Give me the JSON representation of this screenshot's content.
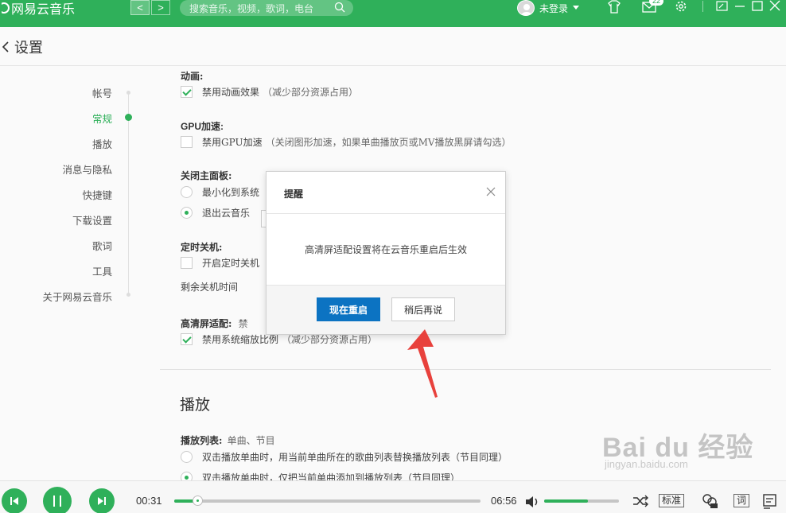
{
  "app": {
    "name": "网易云音乐"
  },
  "topbar": {
    "prev_glyph": "<",
    "next_glyph": ">",
    "search_placeholder": "搜索音乐，视频，歌词，电台",
    "user_label": "未登录",
    "mail_badge": "22"
  },
  "header": {
    "title": "设置"
  },
  "sidebar": {
    "items": [
      {
        "label": "帐号"
      },
      {
        "label": "常规",
        "active": true
      },
      {
        "label": "播放"
      },
      {
        "label": "消息与隐私"
      },
      {
        "label": "快捷键"
      },
      {
        "label": "下载设置"
      },
      {
        "label": "歌词"
      },
      {
        "label": "工具"
      },
      {
        "label": "关于网易云音乐"
      }
    ]
  },
  "settings": {
    "animation": {
      "label": "动画:",
      "option": "禁用动画效果",
      "hint": "（减少部分资源占用）",
      "checked": true
    },
    "gpu": {
      "label": "GPU加速:",
      "option": "禁用GPU加速",
      "hint": "（关闭图形加速，如果单曲播放页或MV播放黑屏请勾选）",
      "checked": false
    },
    "close_panel": {
      "label": "关闭主面板:",
      "options": [
        {
          "label": "最小化到系统",
          "checked": false
        },
        {
          "label": "退出云音乐",
          "checked": true
        }
      ]
    },
    "timer": {
      "label": "定时关机:",
      "option": "开启定时关机",
      "remaining_label": "剩余关机时间"
    },
    "hidpi": {
      "label": "高清屏适配:",
      "extra": "禁",
      "option": "禁用系统缩放比例",
      "hint": "（减少部分资源占用）",
      "checked": true
    }
  },
  "playback_section": {
    "title": "播放",
    "playlist_label": "播放列表:",
    "playlist_sub": "单曲、节目",
    "options": [
      {
        "label": "双击播放单曲时，用当前单曲所在的歌曲列表替换播放列表（节目同理）",
        "checked": false
      },
      {
        "label": "双击播放单曲时，仅把当前单曲添加到播放列表（节目同理）",
        "checked": true
      }
    ]
  },
  "dialog": {
    "title": "提醒",
    "message": "高清屏适配设置将在云音乐重启后生效",
    "primary": "现在重启",
    "secondary": "稍后再说"
  },
  "player": {
    "current_time": "00:31",
    "total_time": "06:56",
    "progress": 0.075,
    "volume": 0.58,
    "quality": "标准",
    "lyric_label": "词"
  },
  "watermark": {
    "text": "Bai du 经验",
    "url": "jingyan.baidu.com"
  },
  "colors": {
    "brand": "#2fb05a",
    "primary_button": "#0c73c2",
    "arrow": "#e8413c"
  }
}
